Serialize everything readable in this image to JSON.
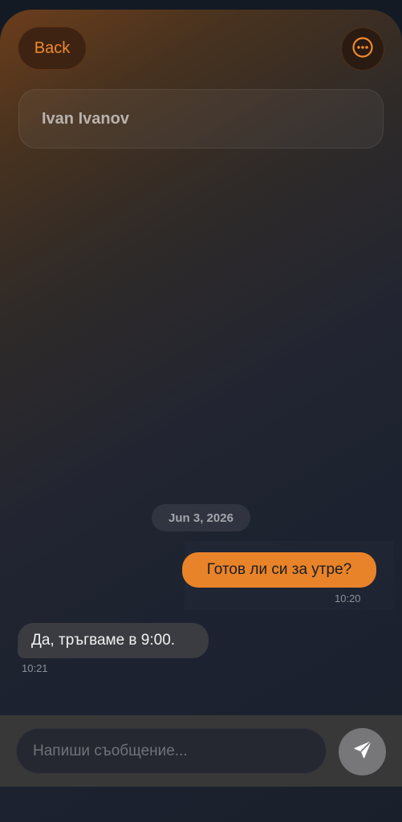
{
  "header": {
    "back_label": "Back",
    "more_icon": "ellipsis-circle-icon",
    "contact_name": "Ivan Ivanov"
  },
  "conversation": {
    "date_separator": "Jun 3, 2026",
    "messages": [
      {
        "direction": "outgoing",
        "text": "Готов ли си за утре?",
        "time": "10:20"
      },
      {
        "direction": "incoming",
        "text": "Да, тръгваме в 9:00.",
        "time": "10:21"
      }
    ]
  },
  "composer": {
    "placeholder": "Напиши съобщение...",
    "value": "",
    "send_icon": "paper-plane-icon"
  },
  "colors": {
    "accent": "#e8832a",
    "incoming_bubble": "#3a3c41",
    "background": "#1a202b"
  }
}
